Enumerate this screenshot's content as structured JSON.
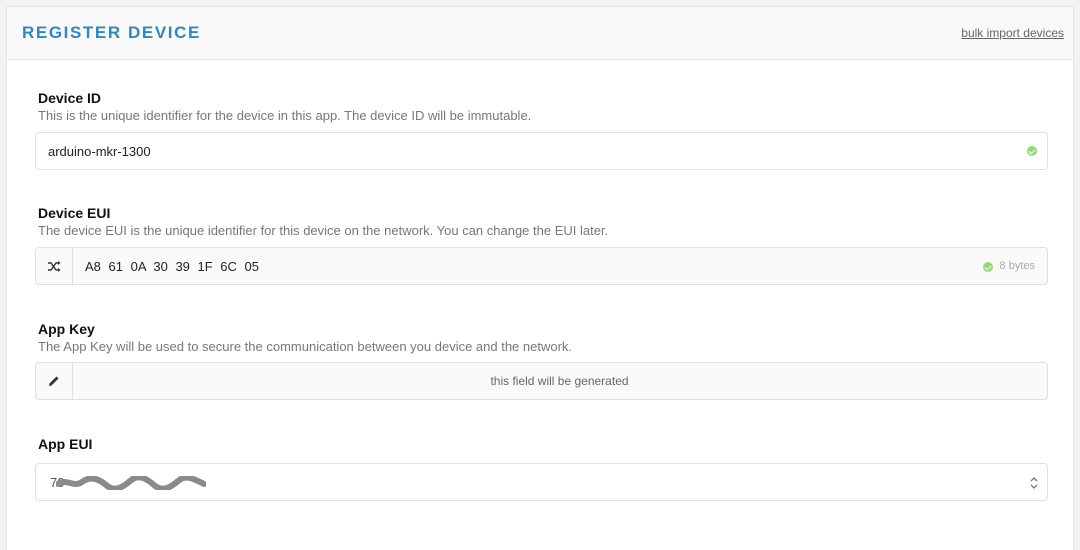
{
  "header": {
    "title": "REGISTER DEVICE",
    "bulk_import_link": "bulk import devices"
  },
  "fields": {
    "device_id": {
      "label": "Device ID",
      "description": "This is the unique identifier for the device in this app. The device ID will be immutable.",
      "value": "arduino-mkr-1300",
      "status_icon": "valid-check-icon",
      "status_color": "#8fdc72"
    },
    "device_eui": {
      "label": "Device EUI",
      "description": "The device EUI is the unique identifier for this device on the network. You can change the EUI later.",
      "value": "A8  61  0A  30  39  1F  6C  05",
      "byte_count": "8 bytes",
      "addon_icon": "shuffle-icon"
    },
    "app_key": {
      "label": "App Key",
      "description": "The App Key will be used to secure the communication between you device and the network.",
      "placeholder": "this field will be generated",
      "addon_icon": "pencil-icon"
    },
    "app_eui": {
      "label": "App EUI",
      "value_prefix": "70",
      "redacted": true,
      "select_icon": "up-down-chevron-icon"
    }
  },
  "colors": {
    "accent": "#2f88c4",
    "valid": "#8fdc72"
  }
}
